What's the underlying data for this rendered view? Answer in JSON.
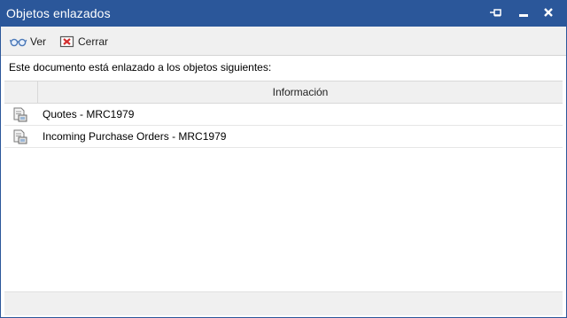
{
  "window": {
    "title": "Objetos enlazados"
  },
  "toolbar": {
    "view_label": "Ver",
    "close_label": "Cerrar"
  },
  "caption": "Este documento está enlazado a los objetos siguientes:",
  "table": {
    "header": "Información",
    "rows": [
      {
        "label": "Quotes - MRC1979"
      },
      {
        "label": "Incoming Purchase Orders - MRC1979"
      }
    ]
  },
  "colors": {
    "titlebar": "#2b579a",
    "toolbar": "#f0f0f0",
    "close_icon": "#d32f2f"
  }
}
